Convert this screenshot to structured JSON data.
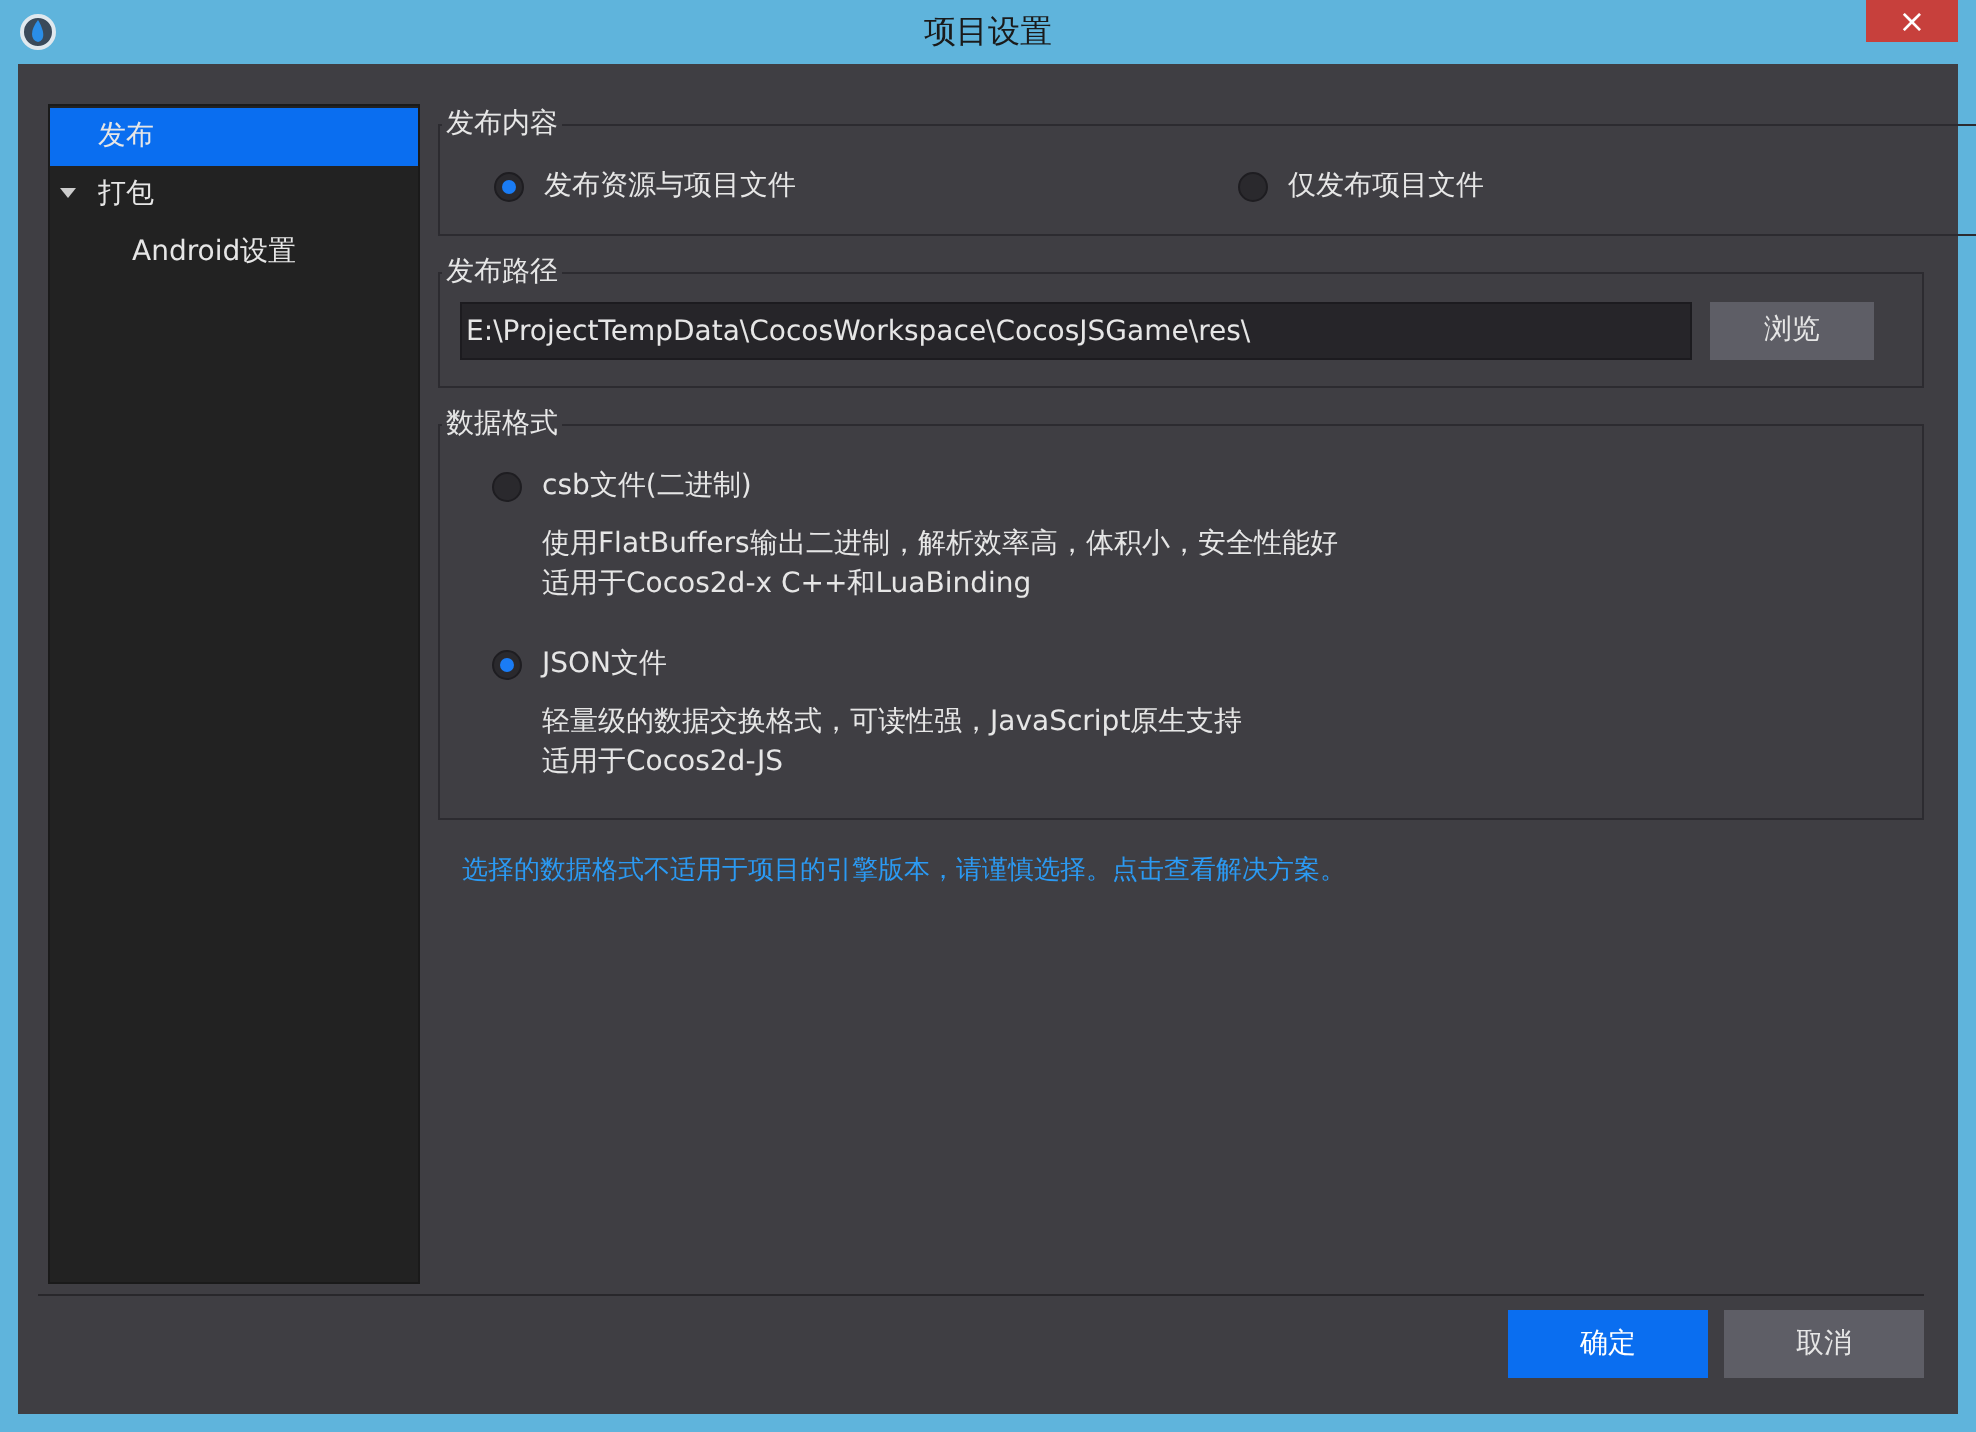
{
  "window": {
    "title": "项目设置",
    "close": "×"
  },
  "sidebar": {
    "items": [
      {
        "label": "发布",
        "selected": true
      },
      {
        "label": "打包",
        "selected": false,
        "expanded": true,
        "children": [
          {
            "label": "Android设置",
            "selected": false
          }
        ]
      }
    ]
  },
  "publish_content": {
    "title": "发布内容",
    "options": [
      {
        "label": "发布资源与项目文件",
        "selected": true
      },
      {
        "label": "仅发布项目文件",
        "selected": false
      }
    ]
  },
  "publish_path": {
    "title": "发布路径",
    "value": "E:\\ProjectTempData\\CocosWorkspace\\CocosJSGame\\res\\",
    "browse": "浏览"
  },
  "data_format": {
    "title": "数据格式",
    "options": [
      {
        "label": "csb文件(二进制)",
        "selected": false,
        "description": [
          "使用FlatBuffers输出二进制，解析效率高，体积小，安全性能好",
          "适用于Cocos2d-x C++和LuaBinding"
        ]
      },
      {
        "label": "JSON文件",
        "selected": true,
        "description": [
          "轻量级的数据交换格式，可读性强，JavaScript原生支持",
          "适用于Cocos2d-JS"
        ]
      }
    ]
  },
  "warning": "选择的数据格式不适用于项目的引擎版本，请谨慎选择。点击查看解决方案。",
  "buttons": [
    {
      "label": "确定",
      "kind": "primary"
    },
    {
      "label": "取消",
      "kind": "secondary"
    }
  ]
}
